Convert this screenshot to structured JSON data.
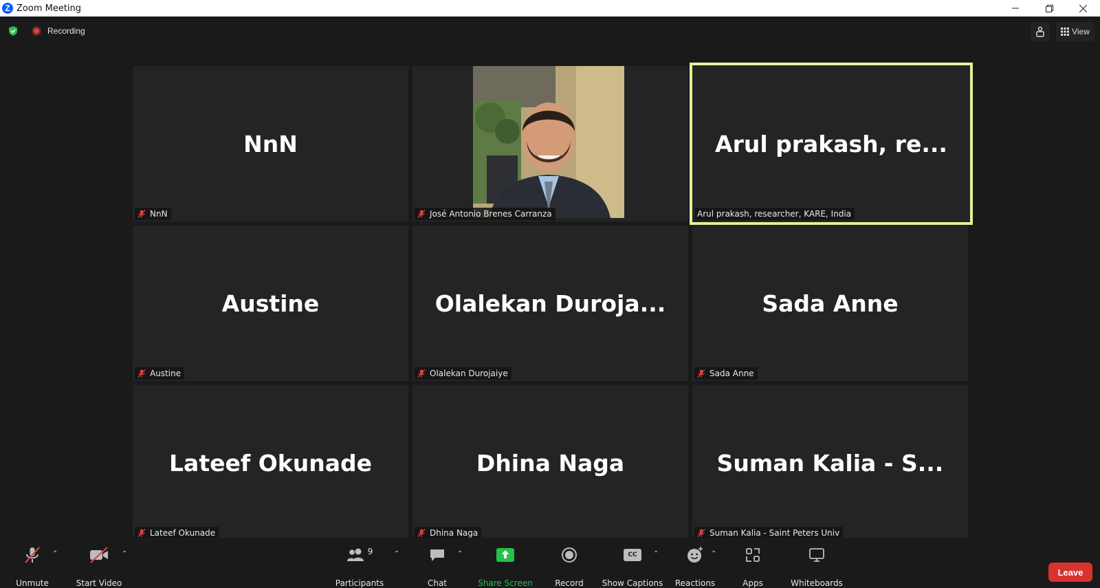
{
  "window": {
    "title": "Zoom Meeting",
    "app_icon": "zoom-logo-icon"
  },
  "top": {
    "recording_label": "Recording",
    "view_label": "View"
  },
  "participants": [
    {
      "display": "NnN",
      "label": "NnN",
      "video": false
    },
    {
      "display": "",
      "label": "José Antonio Brenes Carranza",
      "video": true
    },
    {
      "display": "Arul prakash, re...",
      "label": "Arul prakash, researcher, KARE, India",
      "video": false,
      "active_speaker": true
    },
    {
      "display": "Austine",
      "label": "Austine",
      "video": false
    },
    {
      "display": "Olalekan Duroja...",
      "label": "Olalekan Durojaiye",
      "video": false
    },
    {
      "display": "Sada Anne",
      "label": "Sada Anne",
      "video": false
    },
    {
      "display": "Lateef Okunade",
      "label": "Lateef Okunade",
      "video": false
    },
    {
      "display": "Dhina Naga",
      "label": "Dhina Naga",
      "video": false
    },
    {
      "display": "Suman Kalia - S...",
      "label": "Suman Kalia - Saint Peters Univ",
      "video": false
    }
  ],
  "toolbar": {
    "unmute": "Unmute",
    "start_video": "Start Video",
    "participants": "Participants",
    "participants_count": "9",
    "chat": "Chat",
    "share_screen": "Share Screen",
    "record": "Record",
    "show_captions": "Show Captions",
    "cc_badge": "CC",
    "reactions": "Reactions",
    "apps": "Apps",
    "whiteboards": "Whiteboards",
    "leave": "Leave"
  },
  "colors": {
    "active_speaker_border": "#e6ef9b",
    "leave_button": "#d8332f",
    "share_screen": "#24c14a",
    "muted_icon": "#e0433f"
  }
}
